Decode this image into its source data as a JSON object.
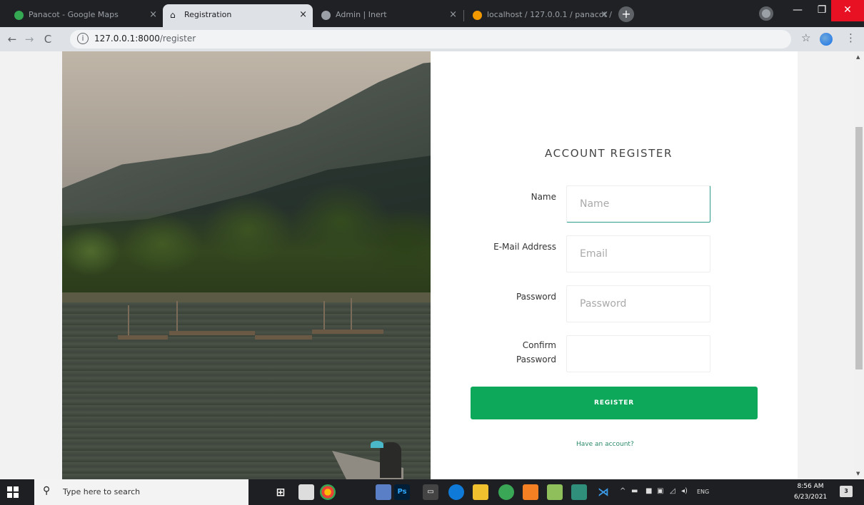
{
  "browser": {
    "tabs": [
      {
        "title": "Panacot - Google Maps",
        "favicon_color": "#34a853"
      },
      {
        "title": "Registration",
        "favicon_color": "#202124"
      },
      {
        "title": "Admin | Inert",
        "favicon_color": "#9aa0a6"
      },
      {
        "title": "localhost / 127.0.0.1 / panacot / ...",
        "favicon_color": "#f29900"
      }
    ],
    "new_tab_label": "+",
    "url_host": "127.0.0.1:8000",
    "url_path": "/register"
  },
  "form": {
    "title": "ACCOUNT REGISTER",
    "name_label": "Name",
    "name_placeholder": "Name",
    "email_label": "E-Mail Address",
    "email_placeholder": "Email",
    "password_label": "Password",
    "password_placeholder": "Password",
    "confirm_label_line1": "Confirm",
    "confirm_label_line2": "Password",
    "register_button": "REGISTER",
    "have_account_link": "Have an account?",
    "accent_color": "#0ea85a"
  },
  "taskbar": {
    "search_placeholder": "Type here to search",
    "time": "8:56 AM",
    "date": "6/23/2021",
    "lang": "ENG",
    "notification_count": "3"
  }
}
